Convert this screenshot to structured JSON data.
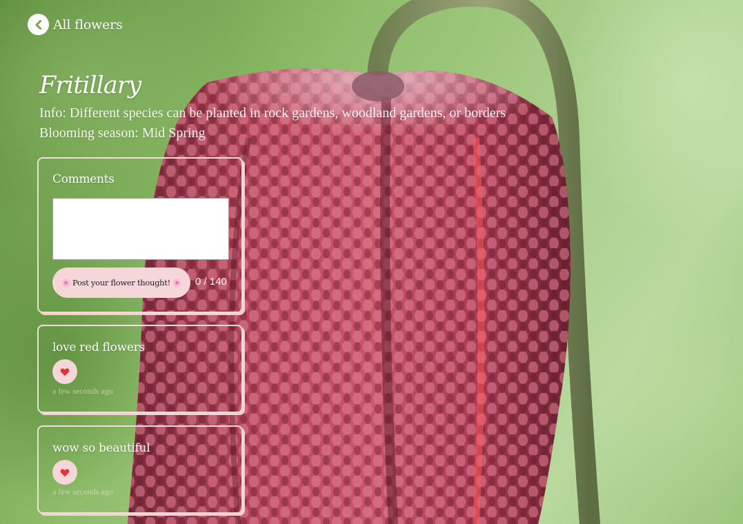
{
  "nav": {
    "back_label": "All flowers"
  },
  "flower": {
    "name": "Fritillary",
    "info": "Info: Different species can be planted in rock gardens, woodland gardens, or borders",
    "season": "Blooming season: Mid Spring"
  },
  "comment_form": {
    "heading": "Comments",
    "textarea_value": "",
    "post_button_label": "Post your flower thought!",
    "post_button_icon": "cherry-blossom-icon",
    "char_counter": "0 / 140"
  },
  "comments": [
    {
      "text": "love red flowers",
      "like_icon": "heart-icon",
      "timestamp": "a few seconds ago"
    },
    {
      "text": "wow so beautiful",
      "like_icon": "heart-icon",
      "timestamp": "a few seconds ago"
    }
  ],
  "colors": {
    "card_border": "#f4dcdc",
    "button_background": "#f5d7da",
    "heart": "#e0343c",
    "text": "#ffffff"
  }
}
